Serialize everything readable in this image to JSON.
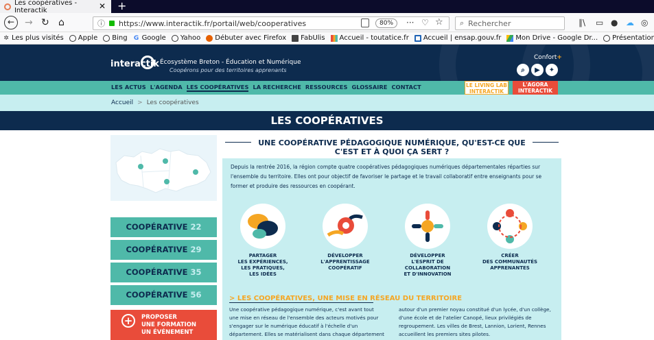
{
  "browser": {
    "tab_title": "Les coopératives - Interactik",
    "tab_close": "✕",
    "new_tab": "+",
    "url": "https://www.interactik.fr/portail/web/cooperatives",
    "zoom": "80%",
    "search_placeholder": "Rechercher",
    "bookmarks": [
      {
        "label": "Les plus visités",
        "icon": "star-gear-icon"
      },
      {
        "label": "Apple",
        "icon": "globe-icon"
      },
      {
        "label": "Bing",
        "icon": "globe-icon"
      },
      {
        "label": "Google",
        "icon": "google-icon"
      },
      {
        "label": "Yahoo",
        "icon": "globe-icon"
      },
      {
        "label": "Débuter avec Firefox",
        "icon": "firefox-icon"
      },
      {
        "label": "FabUlis",
        "icon": "folder-icon"
      },
      {
        "label": "Accueil - toutatice.fr",
        "icon": "toutatice-icon"
      },
      {
        "label": "Accueil | ensap.gouv.fr",
        "icon": "ensap-icon"
      },
      {
        "label": "Mon Drive - Google Dr...",
        "icon": "drive-icon"
      },
      {
        "label": "Présentation [Site péd...",
        "icon": "globe-icon"
      }
    ]
  },
  "site": {
    "logo": "interactik",
    "tagline1": "Écosystème Breton - Éducation et Numérique",
    "tagline2": "Coopérons pour des territoires apprenants",
    "confort": "Confort",
    "confort_plus": "+",
    "menu": [
      "LES ACTUS",
      "L'AGENDA",
      "LES COOPÉRATIVES",
      "LA RECHERCHE",
      "RESSOURCES",
      "GLOSSAIRE",
      "CONTACT"
    ],
    "lab1": "LE LIVING LAB\nINTERACTIK",
    "lab2": "L'AGORA\nINTERACTIK",
    "breadcrumb_home": "Accueil",
    "breadcrumb_sep": ">",
    "breadcrumb_current": "Les coopératives",
    "page_title": "LES COOPÉRATIVES"
  },
  "sidebar": {
    "coop_label": "COOPÉRATIVE",
    "coops": [
      "22",
      "29",
      "35",
      "56"
    ],
    "proposer": "PROPOSER\nUNE FORMATION\nUN ÉVÉNEMENT"
  },
  "main": {
    "title": "UNE COOPÉRATIVE PÉDAGOGIQUE NUMÉRIQUE, QU'EST-CE QUE C'EST ET À QUOI ÇA SERT ?",
    "intro": "Depuis la rentrée 2016, la région compte quatre coopératives pédagogiques numériques départementales réparties sur l'ensemble du territoire. Elles ont pour objectif de favoriser le partage et le travail collaboratif entre enseignants pour se former et produire des ressources en coopérant.",
    "cards": [
      "PARTAGER\nLES EXPÉRIENCES,\nLES PRATIQUES,\nLES IDÉES",
      "DÉVELOPPER\nL'APPRENTISSAGE\nCOOPÉRATIF",
      "DÉVELOPPER\nL'ESPRIT DE\nCOLLABORATION\nET D'INNOVATION",
      "CRÉER\nDES COMMUNAUTÉS\nAPPRENANTES"
    ],
    "section_title": "> LES COOPÉRATIVES, UNE MISE EN RÉSEAU DU TERRITOIRE",
    "col1": "Une coopérative pédagogique numérique, c'est avant tout une mise en réseau de l'ensemble des acteurs motivés pour s'engager sur le numérique éducatif à l'échelle d'un département. Elles se matérialisent dans chaque département",
    "col2": "autour d'un premier noyau constitué d'un lycée, d'un collège, d'une école et de l'atelier Canopé, lieux privilégiés de regroupement. Les villes de Brest, Lannion, Lorient, Rennes accueillent les premiers sites pilotes."
  },
  "colors": {
    "navy": "#0d2b4e",
    "teal": "#4fb9a9",
    "light_teal": "#c7eef0",
    "orange": "#f5a623",
    "red": "#e94c3a"
  }
}
